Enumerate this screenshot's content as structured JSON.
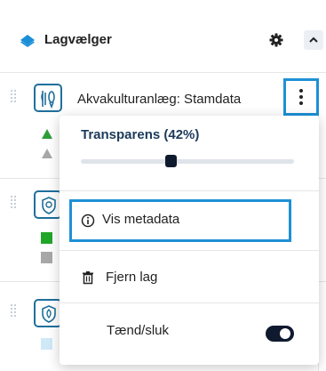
{
  "header": {
    "title": "Lagvælger",
    "icons": {
      "layers": "layers-icon",
      "settings": "gear-icon",
      "collapse": "chevron-up-icon"
    }
  },
  "layers": [
    {
      "name": "Akvakulturanlæg: Stamdata",
      "icon": "fish-icon",
      "legend": [
        {
          "shape": "triangle",
          "color": "#2e9e3a"
        },
        {
          "shape": "triangle",
          "color": "#a8a8a8"
        }
      ]
    },
    {
      "name": "",
      "icon": "shield-pin-icon",
      "legend": [
        {
          "shape": "square",
          "color": "#22a62a"
        },
        {
          "shape": "square",
          "color": "#a8a8a8"
        }
      ]
    },
    {
      "name": "",
      "icon": "leaf-shield-icon",
      "legend": [
        {
          "shape": "square",
          "color": "#cfe9f7"
        }
      ]
    }
  ],
  "menu": {
    "transparency_label": "Transparens (42%)",
    "transparency_value": 0.42,
    "metadata_label": "Vis metadata",
    "remove_label": "Fjern lag",
    "toggle_label": "Tænd/sluk",
    "toggle_on": true,
    "icons": {
      "info": "info-icon",
      "trash": "trash-icon",
      "more": "more-vertical-icon"
    }
  },
  "colors": {
    "accent_blue": "#1e90d6",
    "icon_blue": "#1f6f9c",
    "dark": "#0f1a2e"
  }
}
